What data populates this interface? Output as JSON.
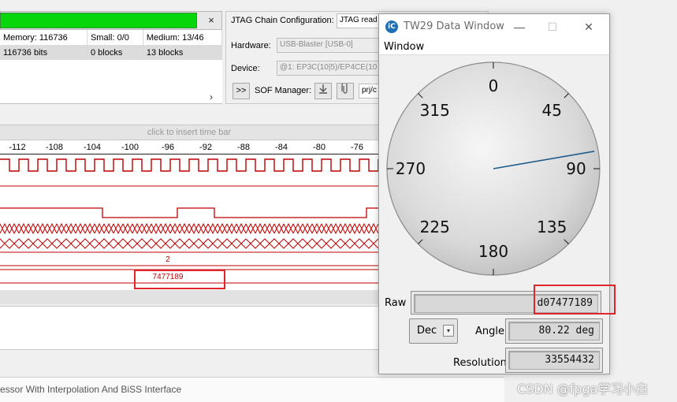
{
  "signaltap": {
    "progress_close": "×",
    "memory": {
      "row1": [
        "Memory: 116736",
        "Small: 0/0",
        "Medium: 13/46"
      ],
      "row2": [
        "116736 bits",
        "0 blocks",
        "13 blocks"
      ]
    },
    "scroll_chevron": "›",
    "jtag": {
      "title": "JTAG Chain Configuration:",
      "status": "JTAG read",
      "hardware_label": "Hardware:",
      "hardware_value": "USB-Blaster [USB-0]",
      "device_label": "Device:",
      "device_value": "@1: EP3C(10|5)/EP4CE(10",
      "sof_expand": ">>",
      "sof_label": "SOF Manager:",
      "sof_file": "prj/c"
    },
    "timebar_hint": "click to insert time bar",
    "ruler_ticks": [
      "-112",
      "-108",
      "-104",
      "-100",
      "-96",
      "-92",
      "-88",
      "-84",
      "-80",
      "-76"
    ],
    "bus_values": {
      "counter": "2",
      "position": "7477189"
    },
    "status_text": "essor With Interpolation And BiSS Interface"
  },
  "tw29": {
    "logo": "iC",
    "title": "TW29 Data Window",
    "controls": {
      "minimize": "—",
      "maximize": "☐",
      "close": "✕"
    },
    "menu": "Window",
    "dial": {
      "labels": [
        "0",
        "45",
        "90",
        "135",
        "180",
        "225",
        "270",
        "315"
      ],
      "needle_angle_deg": 80.22,
      "needle_color": "#1f5f8c"
    },
    "raw_label": "Raw",
    "raw_value": "d07477189",
    "format_button": "Dec",
    "format_arrow": "▾",
    "angle_label": "Angle",
    "angle_value": "80.22 deg",
    "resolution_label": "Resolution",
    "resolution_value": "33554432"
  },
  "watermark": "CSDN @fpga学习小白",
  "colors": {
    "progress": "#06d60a",
    "waveform": "#c00000",
    "highlight": "#e0252b",
    "needle": "#1f5f8c"
  }
}
